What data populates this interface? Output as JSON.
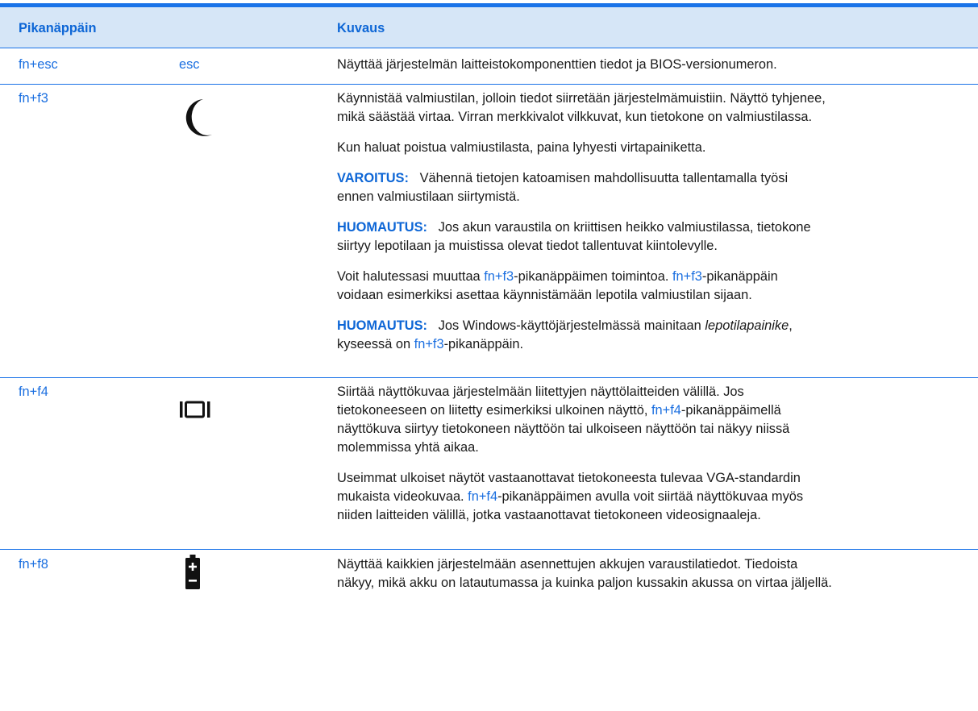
{
  "header": {
    "col1": "Pikanäppäin",
    "col2": "Kuvaus"
  },
  "rows": [
    {
      "key": "fn+esc",
      "icon_text": "esc",
      "desc": [
        {
          "text": "Näyttää järjestelmän laitteistokomponenttien tiedot ja BIOS-versionumeron."
        }
      ]
    },
    {
      "key": "fn+f3",
      "icon": "moon-icon",
      "desc": [
        {
          "line1": "Käynnistää valmiustilan, jolloin tiedot siirretään järjestelmämuistiin. Näyttö tyhjenee,",
          "line2": "mikä säästää virtaa. Virran merkkivalot vilkkuvat, kun tietokone on valmiustilassa."
        },
        {
          "text": "Kun haluat poistua valmiustilasta, paina lyhyesti virtapainiketta."
        },
        {
          "label": "VAROITUS:",
          "line1": "Vähennä tietojen katoamisen mahdollisuutta tallentamalla työsi",
          "line2": "ennen valmiustilaan siirtymistä."
        },
        {
          "label": "HUOMAUTUS:",
          "line1": "Jos akun varaustila on kriittisen heikko valmiustilassa, tietokone",
          "line2": "siirtyy lepotilaan ja muistissa olevat tiedot tallentuvat kiintolevylle."
        },
        {
          "pre": "Voit halutessasi muuttaa ",
          "link1": "fn+f3",
          "mid": "-pikanäppäimen toimintoa. ",
          "link2": "fn+f3",
          "post": "-pikanäppäin",
          "line2": "voidaan esimerkiksi asettaa käynnistämään lepotila valmiustilan sijaan."
        },
        {
          "label": "HUOMAUTUS:",
          "pre": "Jos Windows-käyttöjärjestelmässä mainitaan ",
          "em": "lepotilapainike",
          "post": ",",
          "line2_pre": "kyseessä on ",
          "link": "fn+f3",
          "line2_post": "-pikanäppäin."
        }
      ]
    },
    {
      "key": "fn+f4",
      "icon": "display-switch-icon",
      "desc": [
        {
          "line1": "Siirtää näyttökuvaa järjestelmään liitettyjen näyttölaitteiden välillä. Jos",
          "line2_pre": "tietokoneeseen on liitetty esimerkiksi ulkoinen näyttö, ",
          "link": "fn+f4",
          "line2_post": "-pikanäppäimellä",
          "line3": "näyttökuva siirtyy tietokoneen näyttöön tai ulkoiseen näyttöön tai näkyy niissä",
          "line4": "molemmissa yhtä aikaa."
        },
        {
          "line1": "Useimmat ulkoiset näytöt vastaanottavat tietokoneesta tulevaa VGA-standardin",
          "line2_pre": "mukaista videokuvaa. ",
          "link": "fn+f4",
          "line2_post": "-pikanäppäimen avulla voit siirtää näyttökuvaa myös",
          "line3": "niiden laitteiden välillä, jotka vastaanottavat tietokoneen videosignaaleja."
        }
      ]
    },
    {
      "key": "fn+f8",
      "icon": "battery-icon",
      "desc": [
        {
          "line1": "Näyttää kaikkien järjestelmään asennettujen akkujen varaustilatiedot. Tiedoista",
          "line2": "näkyy, mikä akku on latautumassa ja kuinka paljon kussakin akussa on virtaa jäljellä."
        }
      ]
    }
  ]
}
